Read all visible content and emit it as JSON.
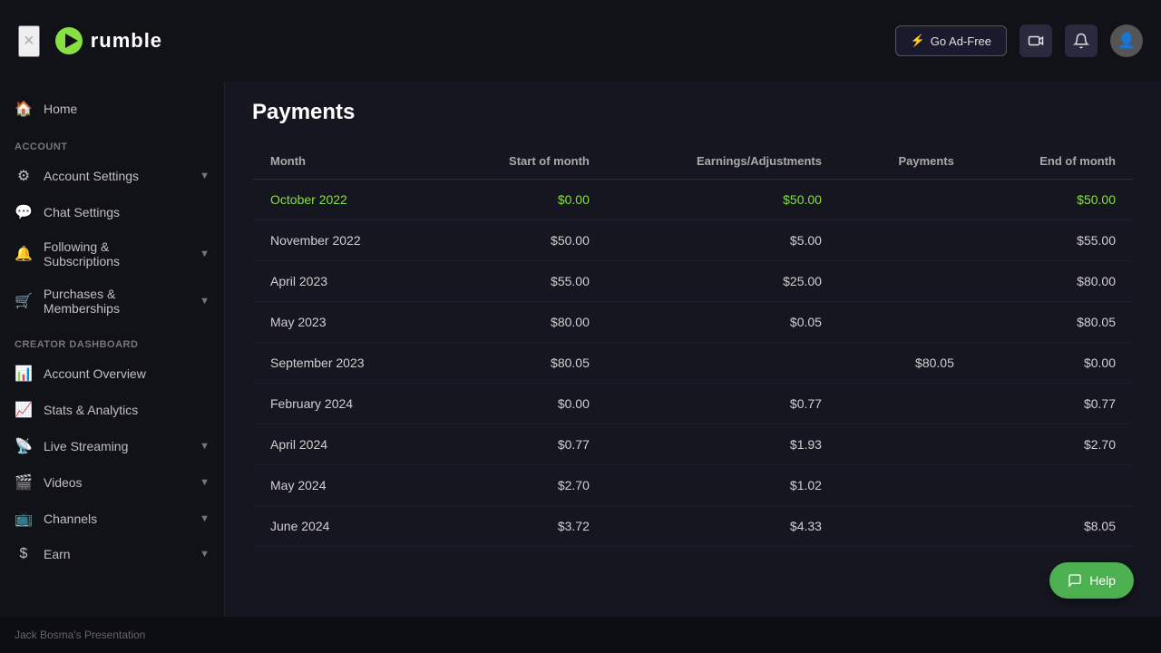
{
  "topbar": {
    "close_label": "×",
    "logo_text": "rumble",
    "go_ad_free_label": "Go Ad-Free",
    "lightning_icon": "⚡"
  },
  "sidebar": {
    "home_label": "Home",
    "account_section": "Account",
    "items_account": [
      {
        "label": "Account Settings",
        "icon": "⚙",
        "has_chevron": true
      },
      {
        "label": "Chat Settings",
        "icon": "💬",
        "has_chevron": false
      },
      {
        "label": "Following & Subscriptions",
        "icon": "🔔",
        "has_chevron": true
      },
      {
        "label": "Purchases & Memberships",
        "icon": "🛒",
        "has_chevron": true
      }
    ],
    "creator_section": "Creator Dashboard",
    "items_creator": [
      {
        "label": "Account Overview",
        "icon": "📊",
        "has_chevron": false
      },
      {
        "label": "Stats & Analytics",
        "icon": "📈",
        "has_chevron": false
      },
      {
        "label": "Live Streaming",
        "icon": "📡",
        "has_chevron": true
      },
      {
        "label": "Videos",
        "icon": "🎬",
        "has_chevron": true
      },
      {
        "label": "Channels",
        "icon": "📺",
        "has_chevron": true
      },
      {
        "label": "Earn",
        "icon": "$",
        "has_chevron": true
      }
    ]
  },
  "content": {
    "page_title": "Payments",
    "table_headers": [
      "Month",
      "Start of month",
      "Earnings/Adjustments",
      "Payments",
      "End of month"
    ],
    "rows": [
      {
        "month": "October 2022",
        "start": "$0.00",
        "earnings": "$50.00",
        "payments": "",
        "end": "$50.00",
        "highlighted": true
      },
      {
        "month": "November 2022",
        "start": "$50.00",
        "earnings": "$5.00",
        "payments": "",
        "end": "$55.00",
        "highlighted": false
      },
      {
        "month": "April 2023",
        "start": "$55.00",
        "earnings": "$25.00",
        "payments": "",
        "end": "$80.00",
        "highlighted": false
      },
      {
        "month": "May 2023",
        "start": "$80.00",
        "earnings": "$0.05",
        "payments": "",
        "end": "$80.05",
        "highlighted": false
      },
      {
        "month": "September 2023",
        "start": "$80.05",
        "earnings": "",
        "payments": "$80.05",
        "end": "$0.00",
        "highlighted": false
      },
      {
        "month": "February 2024",
        "start": "$0.00",
        "earnings": "$0.77",
        "payments": "",
        "end": "$0.77",
        "highlighted": false
      },
      {
        "month": "April 2024",
        "start": "$0.77",
        "earnings": "$1.93",
        "payments": "",
        "end": "$2.70",
        "highlighted": false
      },
      {
        "month": "May 2024",
        "start": "$2.70",
        "earnings": "$1.02",
        "payments": "",
        "end": "",
        "highlighted": false
      },
      {
        "month": "June 2024",
        "start": "$3.72",
        "earnings": "$4.33",
        "payments": "",
        "end": "$8.05",
        "highlighted": false
      }
    ]
  },
  "help_btn_label": "Help",
  "bottom_bar_text": "Jack Bosma's Presentation"
}
